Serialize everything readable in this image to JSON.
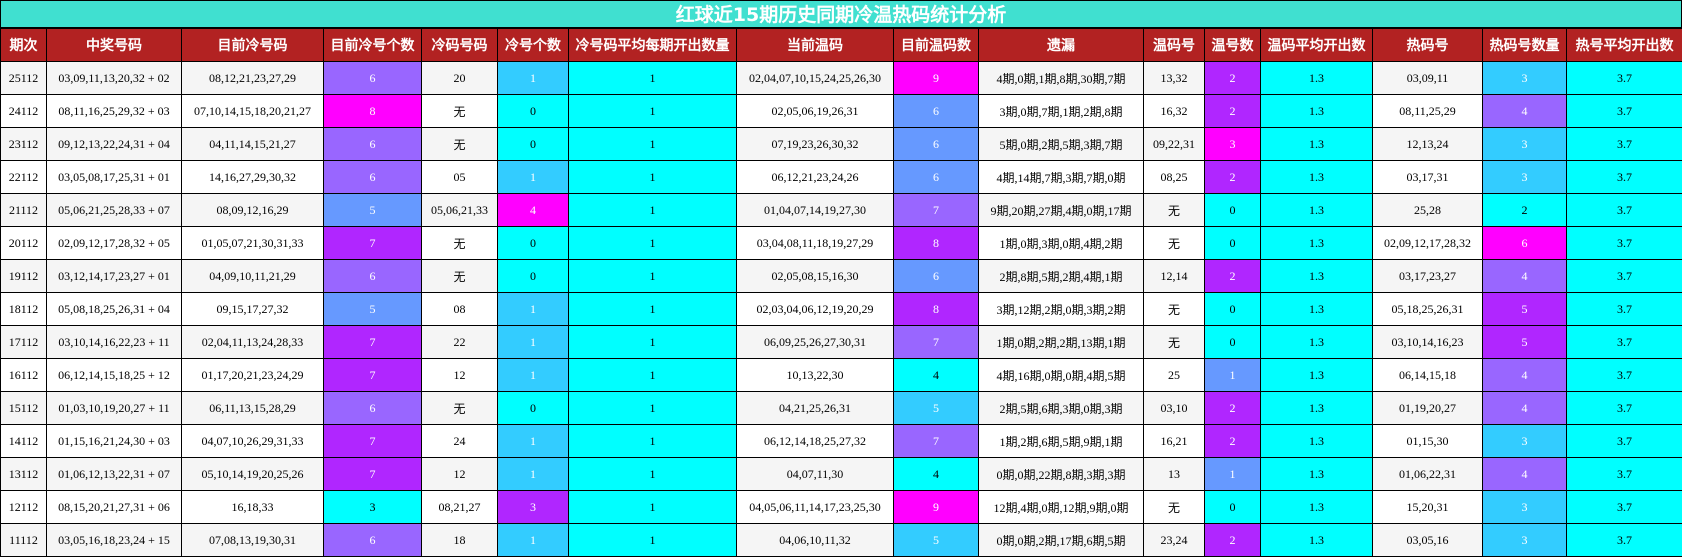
{
  "title": "红球近15期历史同期冷温热码统计分析",
  "headers": [
    "期次",
    "中奖号码",
    "目前冷号码",
    "目前冷号个数",
    "冷码号码",
    "冷号个数",
    "冷号码平均每期开出数量",
    "当前温码",
    "目前温码数",
    "遗漏",
    "温码号",
    "温号数",
    "温码平均开出数",
    "热码号",
    "热码号数量",
    "热号平均开出数"
  ],
  "colors": {
    "title_bg": "#40e0d0",
    "header_bg": "#b22222",
    "cyan": "#00ffff",
    "magenta": "#ff00ff",
    "purple": "#b026ff",
    "violet": "#9966ff",
    "blue": "#6699ff",
    "sky": "#33ccff"
  },
  "rows": [
    {
      "issue": "25112",
      "win": "03,09,11,13,20,32 + 02",
      "cold": "08,12,21,23,27,29",
      "cold_count": "6",
      "cold_code": "20",
      "cold_num": "1",
      "cold_avg": "1",
      "warm": "02,04,07,10,15,24,25,26,30",
      "warm_count": "9",
      "miss": "4期,0期,1期,8期,30期,7期",
      "warm_code": "13,32",
      "warm_num": "2",
      "warm_avg": "1.3",
      "hot": "03,09,11",
      "hot_count": "3",
      "hot_avg": "3.7"
    },
    {
      "issue": "24112",
      "win": "08,11,16,25,29,32 + 03",
      "cold": "07,10,14,15,18,20,21,27",
      "cold_count": "8",
      "cold_code": "无",
      "cold_num": "0",
      "cold_avg": "1",
      "warm": "02,05,06,19,26,31",
      "warm_count": "6",
      "miss": "3期,0期,7期,1期,2期,8期",
      "warm_code": "16,32",
      "warm_num": "2",
      "warm_avg": "1.3",
      "hot": "08,11,25,29",
      "hot_count": "4",
      "hot_avg": "3.7"
    },
    {
      "issue": "23112",
      "win": "09,12,13,22,24,31 + 04",
      "cold": "04,11,14,15,21,27",
      "cold_count": "6",
      "cold_code": "无",
      "cold_num": "0",
      "cold_avg": "1",
      "warm": "07,19,23,26,30,32",
      "warm_count": "6",
      "miss": "5期,0期,2期,5期,3期,7期",
      "warm_code": "09,22,31",
      "warm_num": "3",
      "warm_avg": "1.3",
      "hot": "12,13,24",
      "hot_count": "3",
      "hot_avg": "3.7"
    },
    {
      "issue": "22112",
      "win": "03,05,08,17,25,31 + 01",
      "cold": "14,16,27,29,30,32",
      "cold_count": "6",
      "cold_code": "05",
      "cold_num": "1",
      "cold_avg": "1",
      "warm": "06,12,21,23,24,26",
      "warm_count": "6",
      "miss": "4期,14期,7期,3期,7期,0期",
      "warm_code": "08,25",
      "warm_num": "2",
      "warm_avg": "1.3",
      "hot": "03,17,31",
      "hot_count": "3",
      "hot_avg": "3.7"
    },
    {
      "issue": "21112",
      "win": "05,06,21,25,28,33 + 07",
      "cold": "08,09,12,16,29",
      "cold_count": "5",
      "cold_code": "05,06,21,33",
      "cold_num": "4",
      "cold_avg": "1",
      "warm": "01,04,07,14,19,27,30",
      "warm_count": "7",
      "miss": "9期,20期,27期,4期,0期,17期",
      "warm_code": "无",
      "warm_num": "0",
      "warm_avg": "1.3",
      "hot": "25,28",
      "hot_count": "2",
      "hot_avg": "3.7"
    },
    {
      "issue": "20112",
      "win": "02,09,12,17,28,32 + 05",
      "cold": "01,05,07,21,30,31,33",
      "cold_count": "7",
      "cold_code": "无",
      "cold_num": "0",
      "cold_avg": "1",
      "warm": "03,04,08,11,18,19,27,29",
      "warm_count": "8",
      "miss": "1期,0期,3期,0期,4期,2期",
      "warm_code": "无",
      "warm_num": "0",
      "warm_avg": "1.3",
      "hot": "02,09,12,17,28,32",
      "hot_count": "6",
      "hot_avg": "3.7"
    },
    {
      "issue": "19112",
      "win": "03,12,14,17,23,27 + 01",
      "cold": "04,09,10,11,21,29",
      "cold_count": "6",
      "cold_code": "无",
      "cold_num": "0",
      "cold_avg": "1",
      "warm": "02,05,08,15,16,30",
      "warm_count": "6",
      "miss": "2期,8期,5期,2期,4期,1期",
      "warm_code": "12,14",
      "warm_num": "2",
      "warm_avg": "1.3",
      "hot": "03,17,23,27",
      "hot_count": "4",
      "hot_avg": "3.7"
    },
    {
      "issue": "18112",
      "win": "05,08,18,25,26,31 + 04",
      "cold": "09,15,17,27,32",
      "cold_count": "5",
      "cold_code": "08",
      "cold_num": "1",
      "cold_avg": "1",
      "warm": "02,03,04,06,12,19,20,29",
      "warm_count": "8",
      "miss": "3期,12期,2期,0期,3期,2期",
      "warm_code": "无",
      "warm_num": "0",
      "warm_avg": "1.3",
      "hot": "05,18,25,26,31",
      "hot_count": "5",
      "hot_avg": "3.7"
    },
    {
      "issue": "17112",
      "win": "03,10,14,16,22,23 + 11",
      "cold": "02,04,11,13,24,28,33",
      "cold_count": "7",
      "cold_code": "22",
      "cold_num": "1",
      "cold_avg": "1",
      "warm": "06,09,25,26,27,30,31",
      "warm_count": "7",
      "miss": "1期,0期,2期,2期,13期,1期",
      "warm_code": "无",
      "warm_num": "0",
      "warm_avg": "1.3",
      "hot": "03,10,14,16,23",
      "hot_count": "5",
      "hot_avg": "3.7"
    },
    {
      "issue": "16112",
      "win": "06,12,14,15,18,25 + 12",
      "cold": "01,17,20,21,23,24,29",
      "cold_count": "7",
      "cold_code": "12",
      "cold_num": "1",
      "cold_avg": "1",
      "warm": "10,13,22,30",
      "warm_count": "4",
      "miss": "4期,16期,0期,0期,4期,5期",
      "warm_code": "25",
      "warm_num": "1",
      "warm_avg": "1.3",
      "hot": "06,14,15,18",
      "hot_count": "4",
      "hot_avg": "3.7"
    },
    {
      "issue": "15112",
      "win": "01,03,10,19,20,27 + 11",
      "cold": "06,11,13,15,28,29",
      "cold_count": "6",
      "cold_code": "无",
      "cold_num": "0",
      "cold_avg": "1",
      "warm": "04,21,25,26,31",
      "warm_count": "5",
      "miss": "2期,5期,6期,3期,0期,3期",
      "warm_code": "03,10",
      "warm_num": "2",
      "warm_avg": "1.3",
      "hot": "01,19,20,27",
      "hot_count": "4",
      "hot_avg": "3.7"
    },
    {
      "issue": "14112",
      "win": "01,15,16,21,24,30 + 03",
      "cold": "04,07,10,26,29,31,33",
      "cold_count": "7",
      "cold_code": "24",
      "cold_num": "1",
      "cold_avg": "1",
      "warm": "06,12,14,18,25,27,32",
      "warm_count": "7",
      "miss": "1期,2期,6期,5期,9期,1期",
      "warm_code": "16,21",
      "warm_num": "2",
      "warm_avg": "1.3",
      "hot": "01,15,30",
      "hot_count": "3",
      "hot_avg": "3.7"
    },
    {
      "issue": "13112",
      "win": "01,06,12,13,22,31 + 07",
      "cold": "05,10,14,19,20,25,26",
      "cold_count": "7",
      "cold_code": "12",
      "cold_num": "1",
      "cold_avg": "1",
      "warm": "04,07,11,30",
      "warm_count": "4",
      "miss": "0期,0期,22期,8期,3期,3期",
      "warm_code": "13",
      "warm_num": "1",
      "warm_avg": "1.3",
      "hot": "01,06,22,31",
      "hot_count": "4",
      "hot_avg": "3.7"
    },
    {
      "issue": "12112",
      "win": "08,15,20,21,27,31 + 06",
      "cold": "16,18,33",
      "cold_count": "3",
      "cold_code": "08,21,27",
      "cold_num": "3",
      "cold_avg": "1",
      "warm": "04,05,06,11,14,17,23,25,30",
      "warm_count": "9",
      "miss": "12期,4期,0期,12期,9期,0期",
      "warm_code": "无",
      "warm_num": "0",
      "warm_avg": "1.3",
      "hot": "15,20,31",
      "hot_count": "3",
      "hot_avg": "3.7"
    },
    {
      "issue": "11112",
      "win": "03,05,16,18,23,24 + 15",
      "cold": "07,08,13,19,30,31",
      "cold_count": "6",
      "cold_code": "18",
      "cold_num": "1",
      "cold_avg": "1",
      "warm": "04,06,10,11,32",
      "warm_count": "5",
      "miss": "0期,0期,2期,17期,6期,5期",
      "warm_code": "23,24",
      "warm_num": "2",
      "warm_avg": "1.3",
      "hot": "03,05,16",
      "hot_count": "3",
      "hot_avg": "3.7"
    }
  ]
}
